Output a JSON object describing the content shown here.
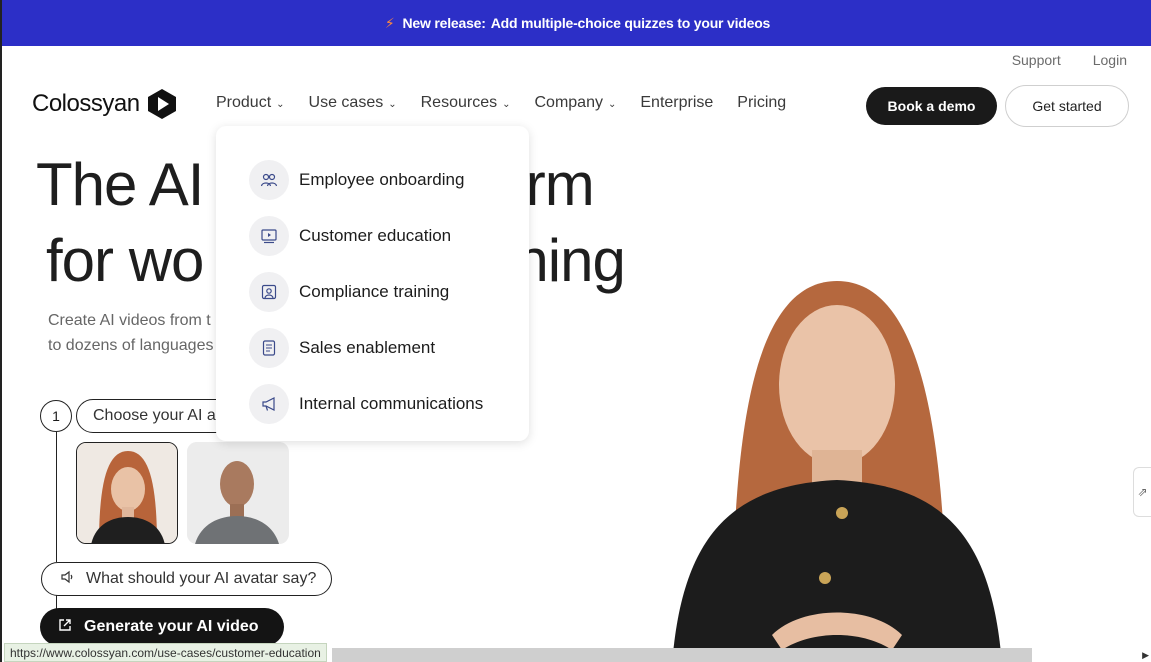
{
  "banner": {
    "icon": "lightning-bolt-icon",
    "label": "New release:",
    "text": "Add multiple-choice quizzes to your videos"
  },
  "top_links": {
    "support": "Support",
    "login": "Login"
  },
  "brand": {
    "name": "Colossyan"
  },
  "nav": {
    "items": [
      {
        "label": "Product",
        "has_menu": true
      },
      {
        "label": "Use cases",
        "has_menu": true
      },
      {
        "label": "Resources",
        "has_menu": true
      },
      {
        "label": "Company",
        "has_menu": true
      },
      {
        "label": "Enterprise",
        "has_menu": false
      },
      {
        "label": "Pricing",
        "has_menu": false
      }
    ],
    "book_demo": "Book a demo",
    "get_started": "Get started"
  },
  "hero": {
    "line1_left": "The AI",
    "line1_right": "orm",
    "line2_left": "for wo",
    "line2_right": "ning",
    "sub1": "Create AI videos from t",
    "sub2": "to dozens of languages"
  },
  "builder": {
    "step_number": "1",
    "choose_label": "Choose your AI a",
    "say_label": "What should your AI avatar say?",
    "generate_label": "Generate your AI video"
  },
  "dropdown": {
    "items": [
      {
        "label": "Employee onboarding",
        "icon": "people-icon"
      },
      {
        "label": "Customer education",
        "icon": "video-screen-icon"
      },
      {
        "label": "Compliance training",
        "icon": "person-frame-icon"
      },
      {
        "label": "Sales enablement",
        "icon": "document-icon"
      },
      {
        "label": "Internal communications",
        "icon": "megaphone-icon"
      }
    ]
  },
  "status_bar": {
    "url": "https://www.colossyan.com/use-cases/customer-education"
  },
  "colors": {
    "banner_bg": "#2c2fc7",
    "dark_button": "#1a1a1a"
  }
}
